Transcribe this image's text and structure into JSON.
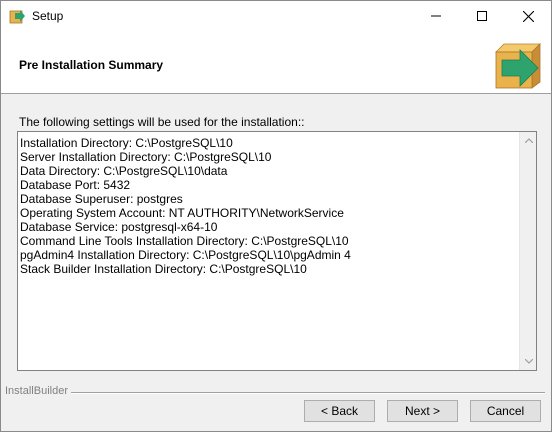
{
  "window": {
    "title": "Setup"
  },
  "header": {
    "title": "Pre Installation Summary"
  },
  "body": {
    "intro": "The following settings will be used for the installation::",
    "lines": [
      "Installation Directory: C:\\PostgreSQL\\10",
      "Server Installation Directory: C:\\PostgreSQL\\10",
      "Data Directory: C:\\PostgreSQL\\10\\data",
      "Database Port: 5432",
      "Database Superuser: postgres",
      "Operating System Account: NT AUTHORITY\\NetworkService",
      "Database Service: postgresql-x64-10",
      "Command Line Tools Installation Directory: C:\\PostgreSQL\\10",
      "pgAdmin4 Installation Directory: C:\\PostgreSQL\\10\\pgAdmin 4",
      "Stack Builder Installation Directory: C:\\PostgreSQL\\10"
    ]
  },
  "footer": {
    "brand": "InstallBuilder",
    "back_label": "< Back",
    "next_label": "Next >",
    "cancel_label": "Cancel"
  },
  "icons": {
    "app": "setup-box-icon",
    "header": "install-arrow-box-icon",
    "minimize": "minimize-icon",
    "maximize": "maximize-icon",
    "close": "close-icon",
    "scroll_up": "chevron-up-icon",
    "scroll_down": "chevron-down-icon"
  },
  "colors": {
    "box": "#e9b24b",
    "arrow": "#2fa36e"
  }
}
